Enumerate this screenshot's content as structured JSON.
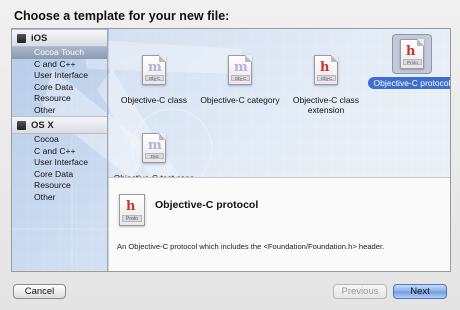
{
  "heading": "Choose a template for your new file:",
  "sidebar": {
    "sections": [
      {
        "title": "iOS",
        "items": [
          "Cocoa Touch",
          "C and C++",
          "User Interface",
          "Core Data",
          "Resource",
          "Other"
        ],
        "selected_index": 0
      },
      {
        "title": "OS X",
        "items": [
          "Cocoa",
          "C and C++",
          "User Interface",
          "Core Data",
          "Resource",
          "Other"
        ],
        "selected_index": -1
      }
    ]
  },
  "templates": [
    {
      "label": "Objective-C class",
      "icon": "objc-class-icon",
      "badge": "Obj-C",
      "glyph": "m",
      "selected": false
    },
    {
      "label": "Objective-C category",
      "icon": "objc-category-icon",
      "badge": "Obj-C",
      "glyph": "m",
      "selected": false
    },
    {
      "label": "Objective-C class extension",
      "icon": "objc-extension-icon",
      "badge": "Obj-C",
      "glyph": "h",
      "selected": false
    },
    {
      "label": "Objective-C protocol",
      "icon": "objc-protocol-icon",
      "badge": "Proto",
      "glyph": "h",
      "selected": true
    },
    {
      "label": "Objective-C test case class",
      "icon": "objc-test-icon",
      "badge": "Test",
      "glyph": "m",
      "selected": false
    }
  ],
  "description": {
    "title": "Objective-C protocol",
    "badge": "Proto",
    "glyph": "h",
    "text": "An Objective-C protocol which includes the <Foundation/Foundation.h> header."
  },
  "buttons": {
    "cancel": "Cancel",
    "previous": "Previous",
    "next": "Next"
  },
  "colors": {
    "selection_blue": "#3d6fd0",
    "header_glyph_red": "#c0392b"
  }
}
